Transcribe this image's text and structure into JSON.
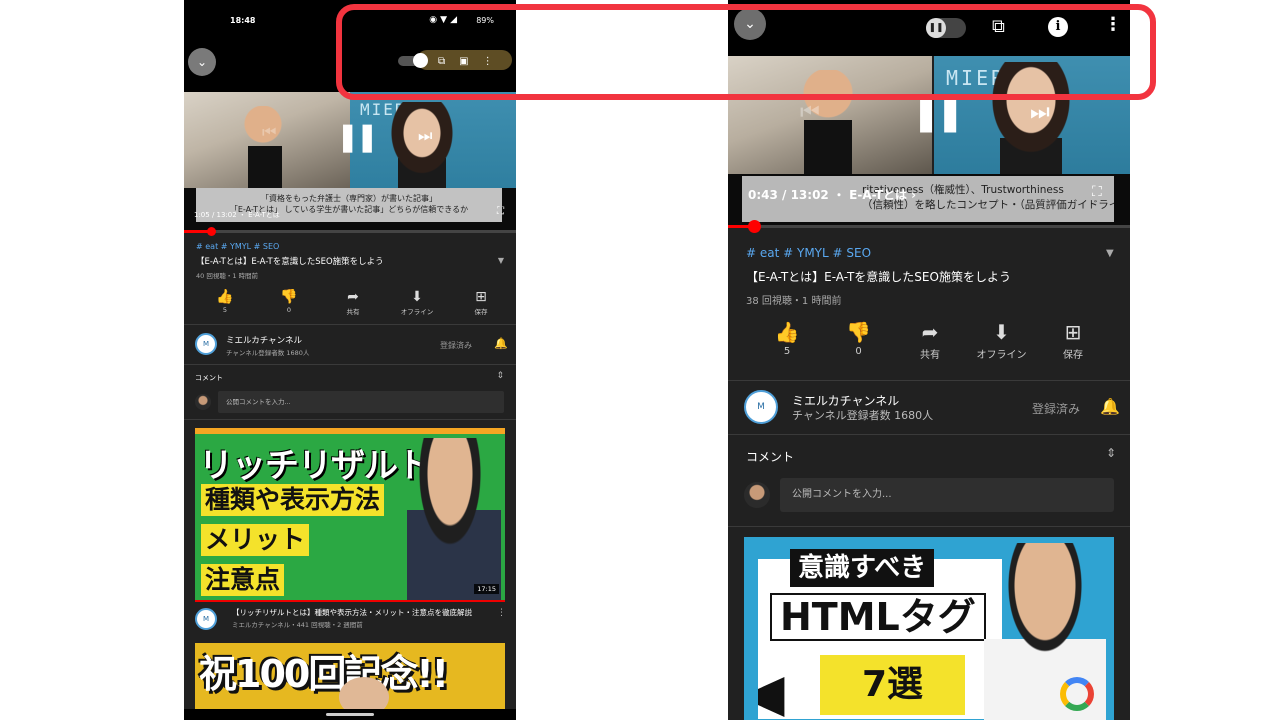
{
  "left_phone": {
    "status": {
      "time": "18:48",
      "battery": "89%"
    },
    "player": {
      "caption_line1": "「資格をもった弁護士（専門家）が書いた記事」",
      "caption_line2": "「E-A-Tとは」 している学生が書いた記事」どちらが信頼できるか",
      "timecode": "1:05 / 13:02 ・ E-A-Tとは"
    },
    "video": {
      "tags": "# eat  # YMYL  # SEO",
      "title": "【E-A-Tとは】E-A-Tを意識したSEO施策をしよう",
      "meta": "40 回視聴・1 時間前",
      "actions": [
        {
          "icon": "thumb-up-icon",
          "glyph": "👍",
          "label": "5"
        },
        {
          "icon": "thumb-down-icon",
          "glyph": "👎",
          "label": "0"
        },
        {
          "icon": "share-icon",
          "glyph": "➦",
          "label": "共有"
        },
        {
          "icon": "download-icon",
          "glyph": "⬇",
          "label": "オフライン"
        },
        {
          "icon": "save-icon",
          "glyph": "⊞",
          "label": "保存"
        }
      ]
    },
    "channel": {
      "avatar_text": "MIERUCA",
      "name": "ミエルカチャンネル",
      "subscribers": "チャンネル登録者数 1680人",
      "subscribed_label": "登録済み"
    },
    "comments": {
      "label": "コメント",
      "placeholder": "公開コメントを入力..."
    },
    "next_video": {
      "thumb_line1": "リッチリザルト",
      "thumb_line2": "種類や表示方法",
      "thumb_line3": "メリット",
      "thumb_line4": "注意点",
      "duration": "17:15",
      "title": "【リッチリザルトとは】種類や表示方法・メリット・注意点を徹底解説",
      "meta": "ミエルカチャンネル・441 回視聴・2 週間前"
    },
    "third_video": {
      "thumb_text": "祝100回記念!!"
    }
  },
  "right_phone": {
    "player": {
      "caption_line1": "ritativeness（権威性）、Trustworthiness",
      "caption_line2": "（信頼性）を略したコンセプト・（品質評価ガイドラインで使われている）造語",
      "timecode": "0:43 / 13:02 ・ E-A-Tとは ›"
    },
    "video": {
      "tags": "# eat  # YMYL  # SEO",
      "title": "【E-A-Tとは】E-A-Tを意識したSEO施策をしよう",
      "meta": "38 回視聴・1 時間前",
      "actions": [
        {
          "icon": "thumb-up-icon",
          "glyph": "👍",
          "label": "5"
        },
        {
          "icon": "thumb-down-icon",
          "glyph": "👎",
          "label": "0"
        },
        {
          "icon": "share-icon",
          "glyph": "➦",
          "label": "共有"
        },
        {
          "icon": "download-icon",
          "glyph": "⬇",
          "label": "オフライン"
        },
        {
          "icon": "save-icon",
          "glyph": "⊞",
          "label": "保存"
        }
      ]
    },
    "channel": {
      "avatar_text": "MIERUCA",
      "name": "ミエルカチャンネル",
      "subscribers": "チャンネル登録者数 1680人",
      "subscribed_label": "登録済み"
    },
    "comments": {
      "label": "コメント",
      "placeholder": "公開コメントを入力..."
    },
    "next_video": {
      "thumb_tag1": "意識すべき",
      "thumb_tag2": "HTMLタグ",
      "thumb_tag3": "7選"
    }
  },
  "highlight_color": "#f2343f"
}
